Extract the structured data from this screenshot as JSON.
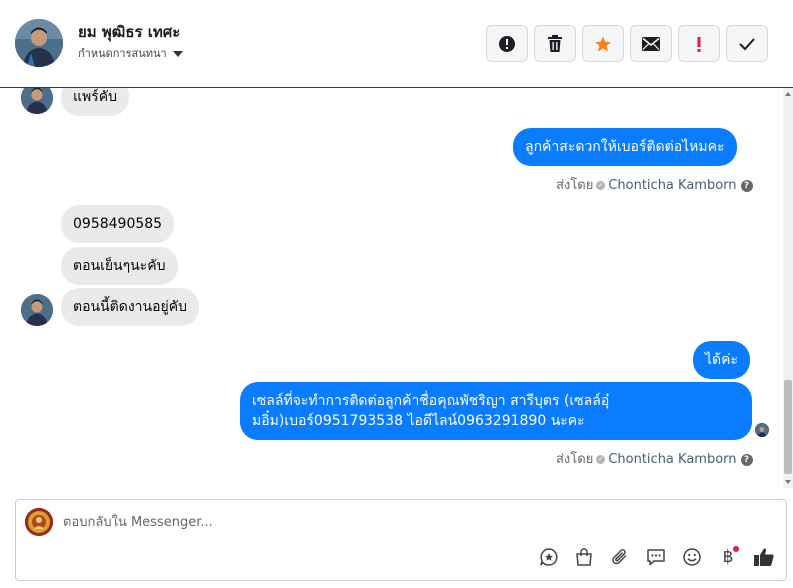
{
  "header": {
    "name": "ยม พุฒิธร เทศะ",
    "status": "กำหนดการสนทนา",
    "actions": [
      {
        "name": "report-spam-button",
        "icon": "alert-circle-icon"
      },
      {
        "name": "delete-button",
        "icon": "trash-icon"
      },
      {
        "name": "star-button",
        "icon": "star-icon"
      },
      {
        "name": "mark-unread-button",
        "icon": "envelope-icon"
      },
      {
        "name": "follow-up-button",
        "icon": "exclamation-icon"
      },
      {
        "name": "mark-done-button",
        "icon": "checkmark-icon"
      }
    ],
    "star_color": "#f5821f",
    "follow_up_color": "#e41e3f"
  },
  "messages": {
    "m1": "แพร์คับ",
    "m2": "ลูกค้าสะดวกให้เบอร์ติดต่อไหมคะ",
    "m3": "0958490585",
    "m4": "ตอนเย็นๆนะคับ",
    "m5": "ตอนนี้ติดงานอยู่คับ",
    "m6": "ได้ค่ะ",
    "m7_line1": "เซลล์ที่จะทำการติดต่อลูกค้าชื่อคุณพัชริญา สารีบุตร (เซลล์อุ๋",
    "m7_line2": "มอิ๋ม)เบอร์0951793538 ไอดีไลน์0963291890 นะคะ"
  },
  "sent_by": {
    "label": "ส่งโดย",
    "agent": "Chonticha Kamborn"
  },
  "composer": {
    "placeholder": "ตอบกลับใน Messenger...",
    "baht_symbol": "฿",
    "tools": [
      "saved-reply-icon",
      "shop-bag-icon",
      "attach-icon",
      "message-icon",
      "emoji-icon",
      "baht-payment-icon",
      "like-icon"
    ]
  },
  "colors": {
    "outgoing_bubble": "#0a7cff",
    "incoming_bubble": "#e9eaec"
  }
}
